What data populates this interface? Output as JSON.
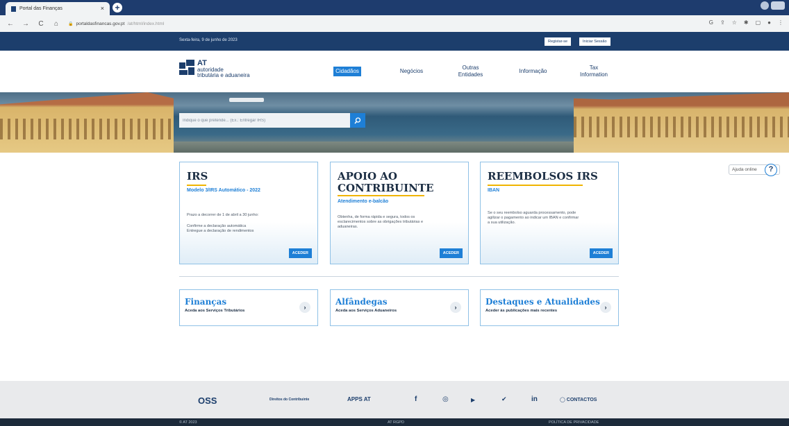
{
  "browser": {
    "tab_title": "Portal das Finanças",
    "url": "portaldasfinancas.gov.pt",
    "url_path": "/at/html/index.html"
  },
  "topbar": {
    "date": "Sexta-feira, 9 de junho de 2023",
    "register": "Registar-se",
    "login": "Iniciar Sessão"
  },
  "logo": {
    "line1": "AT",
    "line2": "autoridade",
    "line3": "tributária e aduaneira"
  },
  "menu": {
    "cidadaos": "Cidadãos",
    "negocios": "Negócios",
    "outras1": "Outras",
    "outras2": "Entidades",
    "informacao": "Informação",
    "tax1": "Tax",
    "tax2": "Information"
  },
  "search": {
    "placeholder": "Indique o que pretende... (Ex.: Entregar IRS)"
  },
  "cards": [
    {
      "title1": "IRS",
      "title2": "",
      "subtitle": "Modelo 3/IRS Automático - 2022",
      "text1": "Prazo a decorrer de 1 de abril a 30 junho:",
      "text2": "Confirme a declaração automática",
      "text3": "Entregue a declaração de rendimentos",
      "button": "ACEDER"
    },
    {
      "title1": "APOIO AO",
      "title2": "CONTRIBUINTE",
      "subtitle": "Atendimento e-balcão",
      "text1": "Obtenha, de forma rápida e segura, todos os",
      "text2": "esclarecimentos sobre as obrigações tributárias e",
      "text3": "aduaneiras.",
      "button": "ACEDER"
    },
    {
      "title1": "REEMBOLSOS IRS",
      "title2": "",
      "subtitle": "IBAN",
      "text1": "Se o seu reembolso aguarda processamento, pode",
      "text2": "agilizar o pagamento ao indicar um IBAN e confirmar",
      "text3": "a sua utilização.",
      "button": "ACEDER"
    }
  ],
  "quick_links": [
    {
      "title": "Finanças",
      "subtitle": "Aceda aos Serviços Tributários"
    },
    {
      "title": "Alfândegas",
      "subtitle": "Aceda aos Serviços Aduaneiros"
    },
    {
      "title": "Destaques e Atualidades",
      "subtitle": "Aceder às publicações mais recentes"
    }
  ],
  "help": {
    "label": "Ajuda online"
  },
  "footer": {
    "oss": "OSS",
    "direitos": "Direitos do Contribuinte",
    "apps": "APPS AT",
    "facebook": "f",
    "youtube": "▶",
    "twitter": "🐦",
    "linkedin": "in",
    "contactos": "CONTACTOS"
  },
  "bottombar": {
    "copyright": "© AT 2023",
    "rgpd": "AT RGPD",
    "privacy": "POLÍTICA DE PRIVACIDADE"
  }
}
